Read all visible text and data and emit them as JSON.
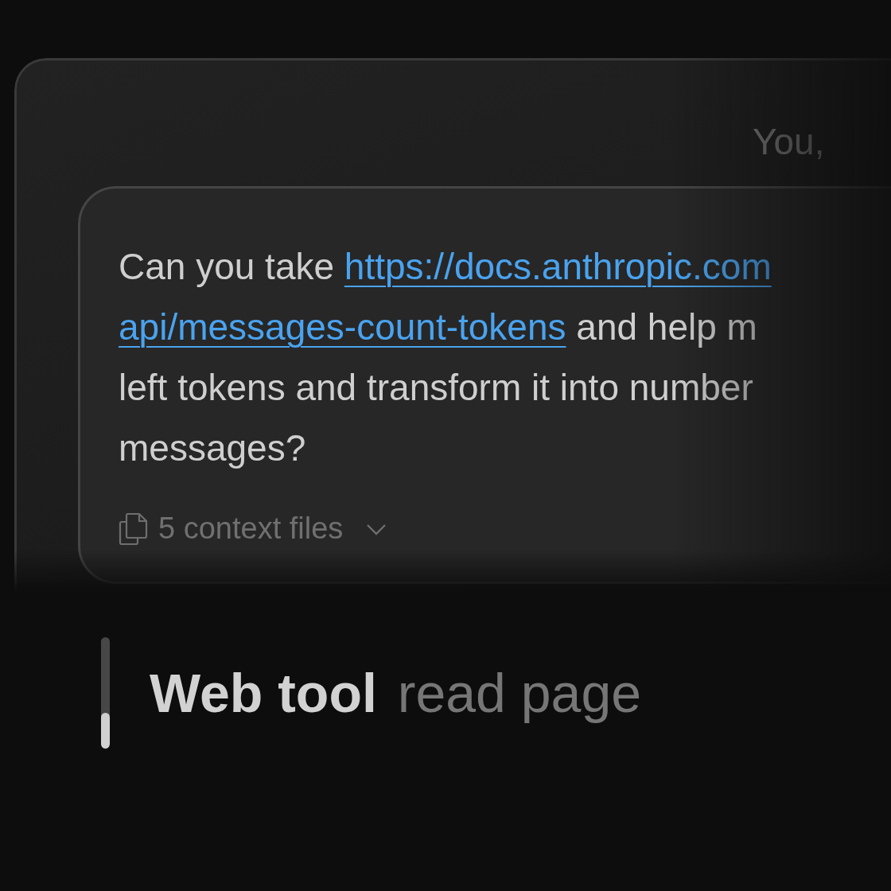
{
  "header": {
    "author": "You,"
  },
  "message": {
    "lines": [
      [
        {
          "kind": "text",
          "text": "Can you take "
        },
        {
          "kind": "link",
          "text": "https://docs.anthropic.com"
        }
      ],
      [
        {
          "kind": "link",
          "text": "api/messages-count-tokens"
        },
        {
          "kind": "text",
          "text": " and help m"
        }
      ],
      [
        {
          "kind": "text",
          "text": "left tokens and transform it into number"
        }
      ],
      [
        {
          "kind": "text",
          "text": "messages?"
        }
      ]
    ],
    "attachments": {
      "label": "5 context files",
      "expanded": false
    }
  },
  "tool_step": {
    "name": "Web tool",
    "action": "read page",
    "level": 0.32
  }
}
